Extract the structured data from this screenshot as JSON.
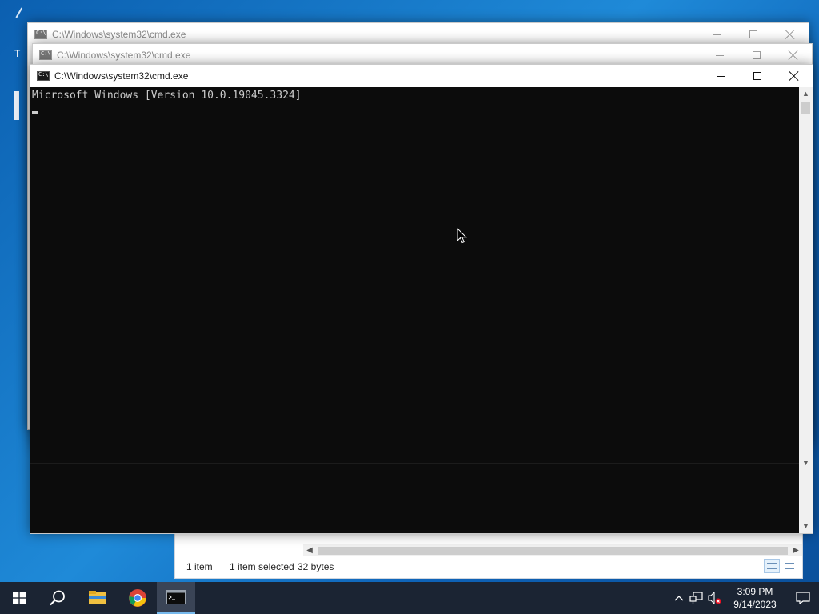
{
  "desktop": {
    "icon_letter": "T"
  },
  "windows": [
    {
      "title": "C:\\Windows\\system32\\cmd.exe"
    },
    {
      "title": "C:\\Windows\\system32\\cmd.exe"
    },
    {
      "title": "C:\\Windows\\system32\\cmd.exe",
      "console_lines": [
        "Microsoft Windows [Version 10.0.19045.3324]"
      ]
    }
  ],
  "explorer": {
    "item_count": "1 item",
    "selection": "1 item selected",
    "size": "32 bytes"
  },
  "taskbar": {
    "buttons": [
      "start-icon",
      "search-icon",
      "file-explorer-icon",
      "chrome-icon",
      "cmd-icon"
    ],
    "time": "3:09 PM",
    "date": "9/14/2023"
  },
  "colors": {
    "console_bg": "#0c0c0c",
    "console_fg": "#cccccc",
    "taskbar_bg": "#1b2433",
    "desktop_blue": "#1f8ad8"
  }
}
